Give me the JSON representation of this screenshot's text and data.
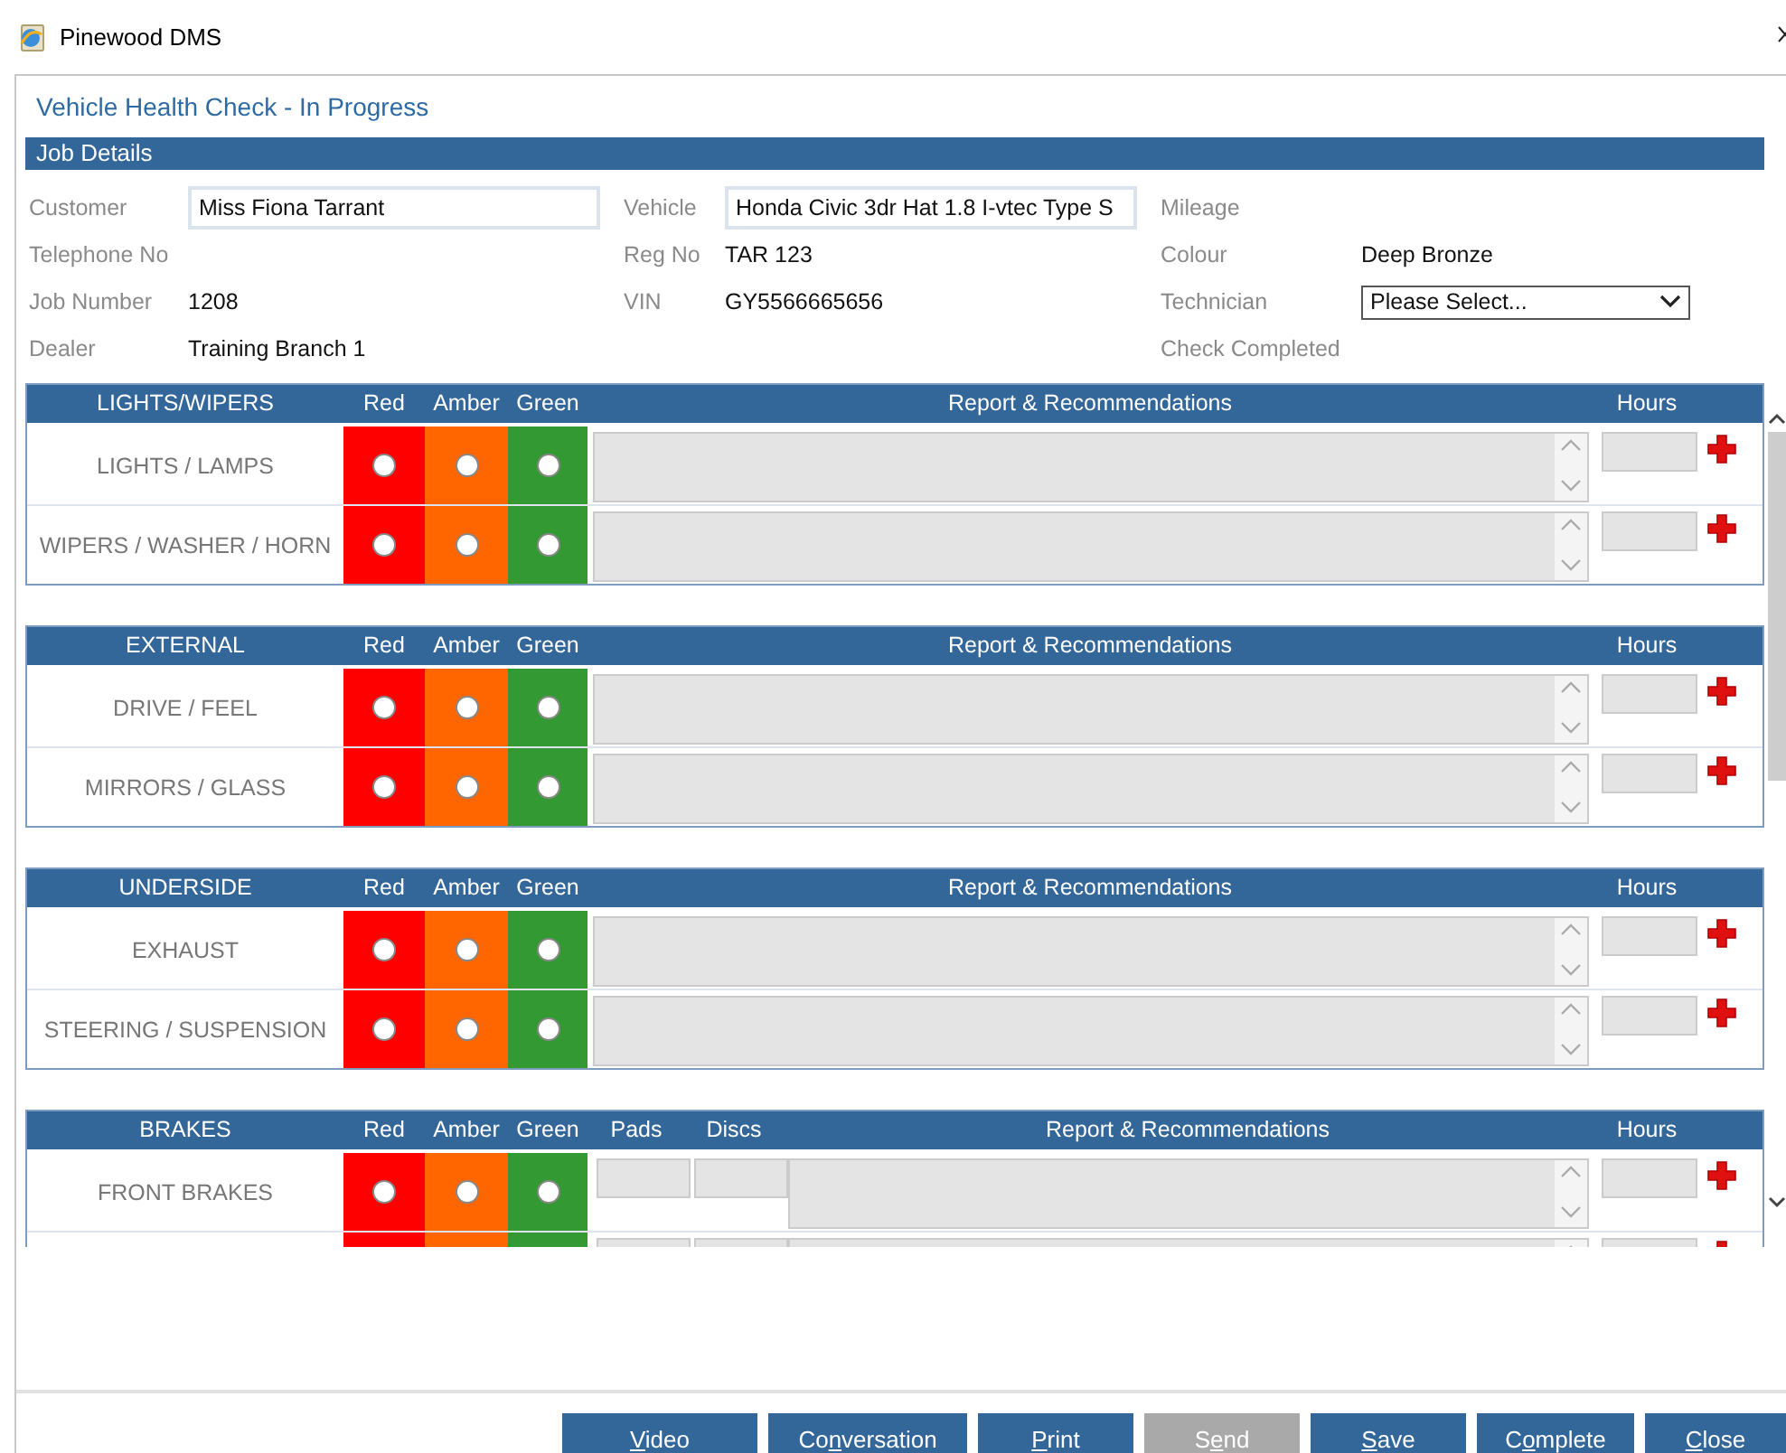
{
  "window": {
    "title": "Pinewood DMS"
  },
  "page_title": "Vehicle Health Check - In Progress",
  "job_details": {
    "heading": "Job Details",
    "fields": [
      {
        "label": "Customer",
        "kind": "input",
        "value": "Miss Fiona Tarrant"
      },
      {
        "label": "Vehicle",
        "kind": "input",
        "value": "Honda Civic 3dr Hat 1.8 I-vtec Type S"
      },
      {
        "label": "Mileage",
        "kind": "text"
      },
      {
        "label": "Telephone No",
        "kind": "text"
      },
      {
        "label": "Reg No",
        "kind": "text",
        "value": "TAR 123"
      },
      {
        "label": "Colour",
        "kind": "text",
        "value": "Deep Bronze"
      },
      {
        "label": "Job Number",
        "kind": "text",
        "value": "1208"
      },
      {
        "label": "VIN",
        "kind": "text",
        "value": "GY5566665656"
      },
      {
        "label": "Technician",
        "kind": "select",
        "value": "Please Select..."
      },
      {
        "label": "Dealer",
        "kind": "text",
        "value": "Training Branch 1"
      },
      {
        "kind": "blank"
      },
      {
        "label": "Check Completed",
        "kind": "text"
      }
    ]
  },
  "sections": [
    {
      "title": "LIGHTS/WIPERS",
      "rating_columns": [
        {
          "label": "Red",
          "color": "#ff0000"
        },
        {
          "label": "Amber",
          "color": "#ff6600"
        },
        {
          "label": "Green",
          "color": "#339933"
        }
      ],
      "report_heading": "Report & Recommendations",
      "hours_heading": "Hours",
      "rows": [
        {
          "label": "LIGHTS / LAMPS",
          "ratings": [
            {
              "selected": false
            },
            {
              "selected": false
            },
            {
              "selected": false
            }
          ]
        },
        {
          "label": "WIPERS / WASHER / HORN",
          "ratings": [
            {
              "selected": false
            },
            {
              "selected": false
            },
            {
              "selected": false
            }
          ]
        }
      ]
    },
    {
      "title": "EXTERNAL",
      "rating_columns": [
        {
          "label": "Red",
          "color": "#ff0000"
        },
        {
          "label": "Amber",
          "color": "#ff6600"
        },
        {
          "label": "Green",
          "color": "#339933"
        }
      ],
      "report_heading": "Report & Recommendations",
      "hours_heading": "Hours",
      "rows": [
        {
          "label": "DRIVE / FEEL",
          "ratings": [
            {
              "selected": false
            },
            {
              "selected": false
            },
            {
              "selected": false
            }
          ]
        },
        {
          "label": "MIRRORS / GLASS",
          "ratings": [
            {
              "selected": false
            },
            {
              "selected": false
            },
            {
              "selected": false
            }
          ]
        }
      ]
    },
    {
      "title": "UNDERSIDE",
      "rating_columns": [
        {
          "label": "Red",
          "color": "#ff0000"
        },
        {
          "label": "Amber",
          "color": "#ff6600"
        },
        {
          "label": "Green",
          "color": "#339933"
        }
      ],
      "report_heading": "Report & Recommendations",
      "hours_heading": "Hours",
      "rows": [
        {
          "label": "EXHAUST",
          "ratings": [
            {
              "selected": false
            },
            {
              "selected": false
            },
            {
              "selected": false
            }
          ]
        },
        {
          "label": "STEERING / SUSPENSION",
          "ratings": [
            {
              "selected": false
            },
            {
              "selected": false
            },
            {
              "selected": false
            }
          ]
        }
      ]
    },
    {
      "title": "BRAKES",
      "rating_columns": [
        {
          "label": "Red",
          "color": "#ff0000"
        },
        {
          "label": "Amber",
          "color": "#ff6600"
        },
        {
          "label": "Green",
          "color": "#339933"
        }
      ],
      "extra_columns": [
        "Pads",
        "Discs"
      ],
      "report_heading": "Report & Recommendations",
      "hours_heading": "Hours",
      "rows": [
        {
          "label": "FRONT BRAKES",
          "ratings": [
            {
              "selected": false
            },
            {
              "selected": false
            },
            {
              "selected": false
            }
          ]
        },
        {}
      ]
    }
  ],
  "buttons": [
    {
      "access_key": "V",
      "label_end": "ideo",
      "disabled": false
    },
    {
      "label_start": "Co",
      "access_key": "n",
      "label_end": "versation",
      "disabled": false
    },
    {
      "access_key": "P",
      "label_end": "rint",
      "disabled": false
    },
    {
      "label_start": "S",
      "access_key": "e",
      "label_end": "nd",
      "disabled": true
    },
    {
      "access_key": "S",
      "label_end": "ave",
      "disabled": false
    },
    {
      "label_start": "C",
      "access_key": "o",
      "label_end": "mplete",
      "disabled": false
    },
    {
      "access_key": "C",
      "label_end": "lose",
      "disabled": false
    }
  ]
}
